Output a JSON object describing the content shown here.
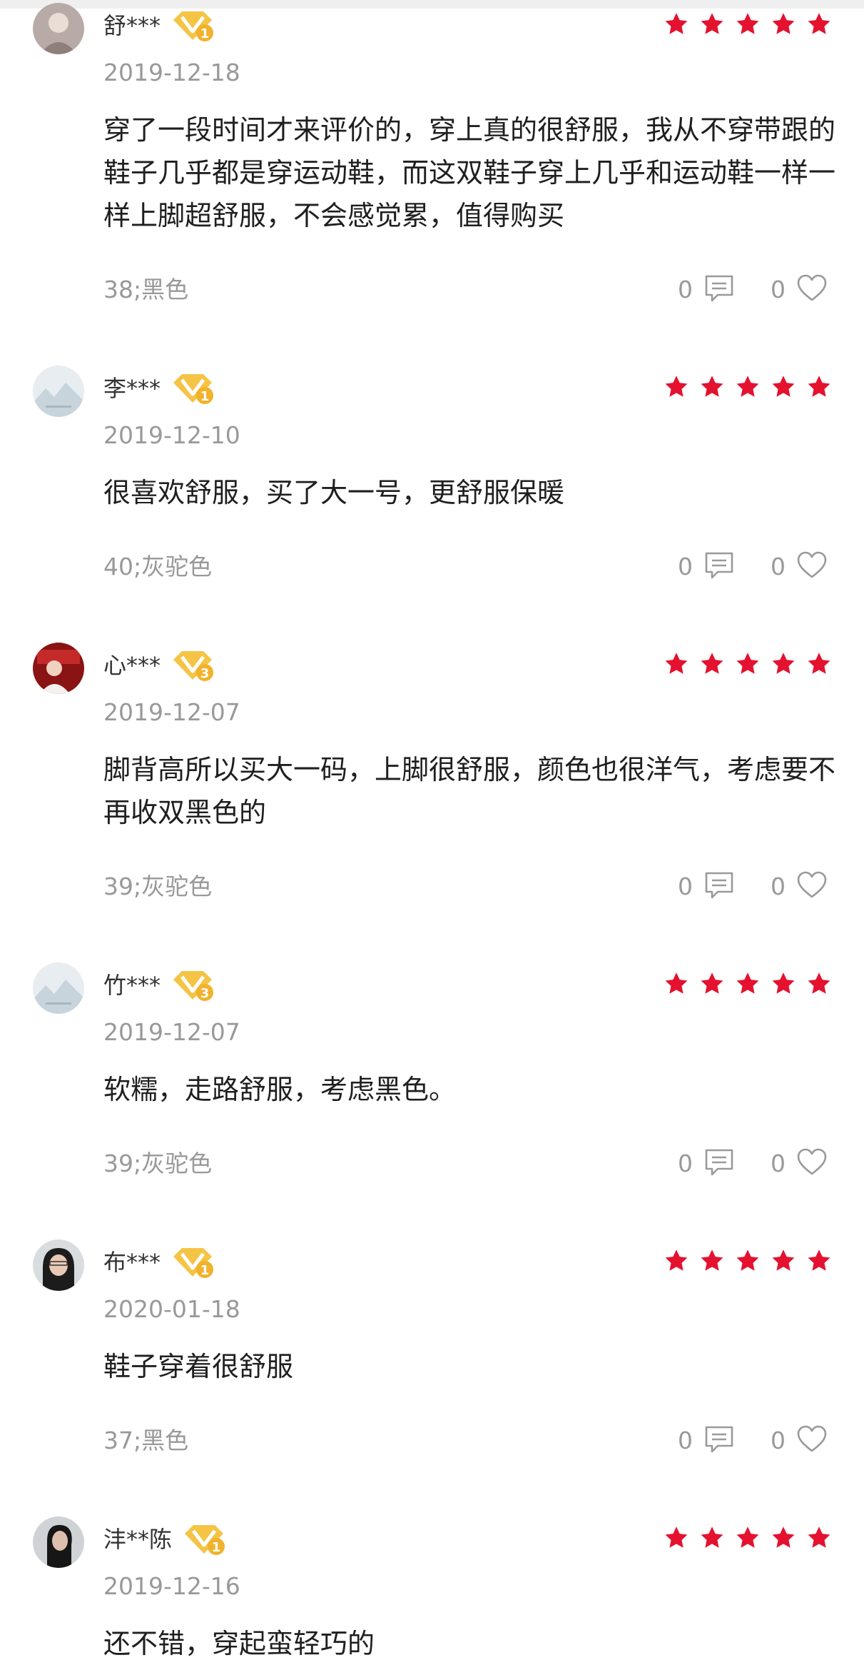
{
  "theme": {
    "star_color": "#e4122f",
    "muted_text": "#999999",
    "badge_gold": "#f5c445"
  },
  "reviews": [
    {
      "username": "舒***",
      "level": "1",
      "stars": 5,
      "date": "2019-12-18",
      "content": "穿了一段时间才来评价的，穿上真的很舒服，我从不穿带跟的鞋子几乎都是穿运动鞋，而这双鞋子穿上几乎和运动鞋一样一样上脚超舒服，不会感觉累，值得购买",
      "spec": "38;黑色",
      "comment_count": "0",
      "like_count": "0",
      "avatar": "photo-avatar-icon"
    },
    {
      "username": "李***",
      "level": "1",
      "stars": 5,
      "date": "2019-12-10",
      "content": "很喜欢舒服，买了大一号，更舒服保暖",
      "spec": "40;灰驼色",
      "comment_count": "0",
      "like_count": "0",
      "avatar": "default-avatar-icon"
    },
    {
      "username": "心***",
      "level": "3",
      "stars": 5,
      "date": "2019-12-07",
      "content": "脚背高所以买大一码，上脚很舒服，颜色也很洋气，考虑要不再收双黑色的",
      "spec": "39;灰驼色",
      "comment_count": "0",
      "like_count": "0",
      "avatar": "photo-avatar-icon"
    },
    {
      "username": "竹***",
      "level": "3",
      "stars": 5,
      "date": "2019-12-07",
      "content": "软糯，走路舒服，考虑黑色。",
      "spec": "39;灰驼色",
      "comment_count": "0",
      "like_count": "0",
      "avatar": "default-avatar-icon"
    },
    {
      "username": "布***",
      "level": "1",
      "stars": 5,
      "date": "2020-01-18",
      "content": "鞋子穿着很舒服",
      "spec": "37;黑色",
      "comment_count": "0",
      "like_count": "0",
      "avatar": "photo-avatar-icon"
    },
    {
      "username": "沣**陈",
      "level": "1",
      "stars": 5,
      "date": "2019-12-16",
      "content": "还不错，穿起蛮轻巧的",
      "spec": "",
      "comment_count": "",
      "like_count": "",
      "avatar": "photo-avatar-icon"
    }
  ]
}
